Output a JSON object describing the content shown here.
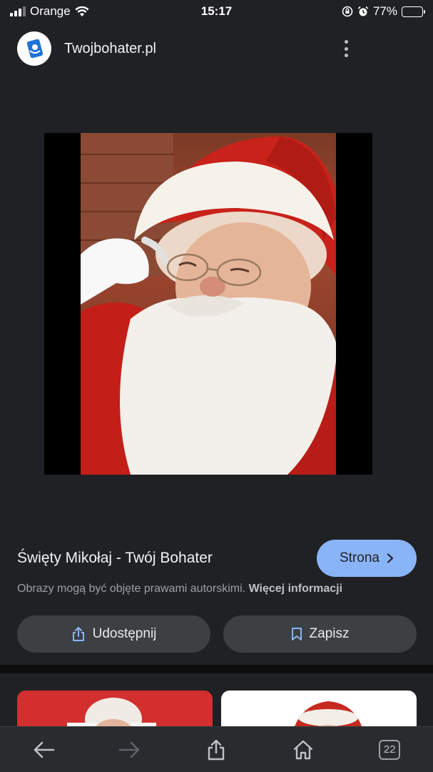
{
  "status": {
    "carrier": "Orange",
    "time": "15:17",
    "battery": "77%",
    "battery_level": 0.77
  },
  "site": {
    "name": "Twojbohater.pl",
    "logo_icon": "phone-hero-icon"
  },
  "result": {
    "title": "Święty Mikołaj - Twój Bohater",
    "visit_label": "Strona",
    "copyright_text": "Obrazy mogą być objęte prawami autorskimi.",
    "copyright_link": "Więcej informacji",
    "share_label": "Udostępnij",
    "save_label": "Zapisz"
  },
  "toolbar": {
    "tabs_count": "22",
    "icons": [
      "back-arrow-icon",
      "forward-arrow-icon",
      "share-icon",
      "home-icon",
      "tabs-icon"
    ]
  },
  "colors": {
    "background": "#202124",
    "accent": "#8ab4f8",
    "button_bg": "#3c4043"
  }
}
